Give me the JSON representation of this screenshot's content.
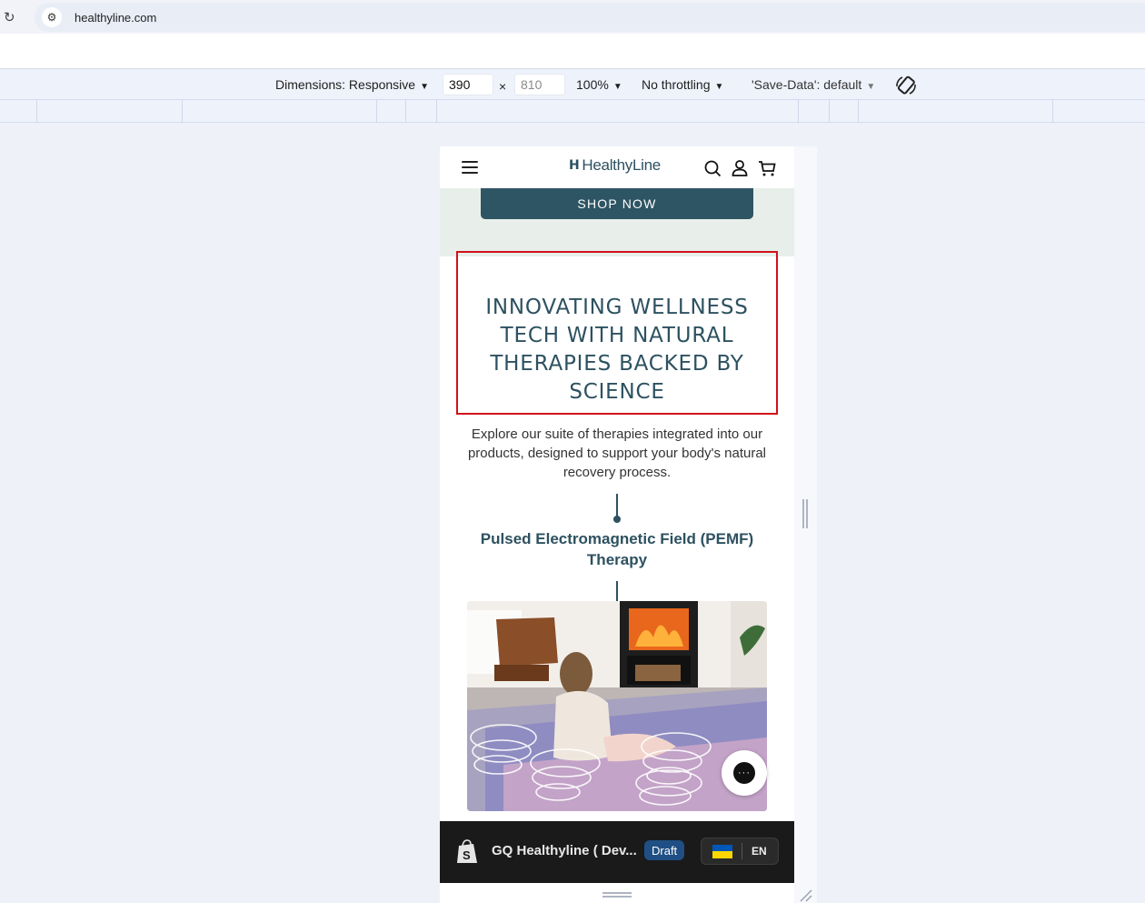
{
  "browser": {
    "url": "healthyline.com"
  },
  "devtools": {
    "dimensions_label": "Dimensions: Responsive",
    "width": "390",
    "height": "810",
    "times": "×",
    "zoom": "100%",
    "throttling": "No throttling",
    "save_data": "'Save-Data': default"
  },
  "site": {
    "logo_text": "HealthyLine",
    "logo_mark": "H",
    "shop_now": "SHOP NOW",
    "headline": "INNOVATING WELLNESS TECH WITH NATURAL THERAPIES BACKED BY SCIENCE",
    "intro": "Explore our suite of therapies integrated into our products, designed to support your body's natural recovery process.",
    "therapy_title": "Pulsed Electromagnetic Field (PEMF) Therapy",
    "chat_glyph": "···"
  },
  "admin_bar": {
    "store_name": "GQ Healthyline ( Dev...",
    "status_badge": "Draft",
    "language": "EN"
  },
  "colors": {
    "brand": "#2d5160",
    "hero_band": "#e8efea",
    "highlight": "#d0111b",
    "admin_bar": "#1a1a1a",
    "draft_badge": "#1f4f84"
  }
}
